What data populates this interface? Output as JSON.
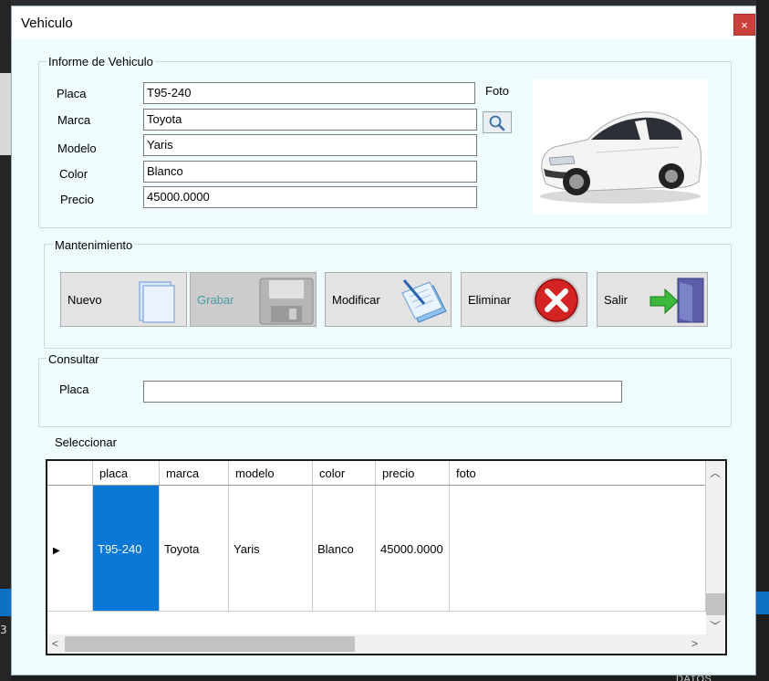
{
  "window": {
    "title": "Vehiculo",
    "close_label": "×"
  },
  "info_group": {
    "title": "Informe de Vehiculo",
    "photo_label": "Foto",
    "fields": {
      "placa": {
        "label": "Placa",
        "value": "T95-240"
      },
      "marca": {
        "label": "Marca",
        "value": "Toyota"
      },
      "modelo": {
        "label": "Modelo",
        "value": "Yaris"
      },
      "color": {
        "label": "Color",
        "value": "Blanco"
      },
      "precio": {
        "label": "Precio",
        "value": "45000.0000"
      }
    }
  },
  "maintenance_group": {
    "title": "Mantenimiento",
    "buttons": {
      "nuevo": "Nuevo",
      "grabar": "Grabar",
      "modificar": "Modificar",
      "eliminar": "Eliminar",
      "salir": "Salir"
    }
  },
  "consult_group": {
    "title": "Consultar",
    "placa_label": "Placa",
    "placa_value": ""
  },
  "select_label": "Seleccionar",
  "grid": {
    "columns": [
      "placa",
      "marca",
      "modelo",
      "color",
      "precio",
      "foto"
    ],
    "rows": [
      {
        "placa": "T95-240",
        "marca": "Toyota",
        "modelo": "Yaris",
        "color": "Blanco",
        "precio": "45000.0000",
        "foto": ""
      }
    ],
    "row_indicator": "▶",
    "scroll_up": "︿",
    "scroll_down": "﹀",
    "scroll_left": "<",
    "scroll_right": ">"
  },
  "background": {
    "left_number": "3",
    "bottom_text": "DATOS"
  },
  "colors": {
    "selection": "#0a78d7",
    "close_button": "#c9413a",
    "form_background": "#eefcfd"
  }
}
